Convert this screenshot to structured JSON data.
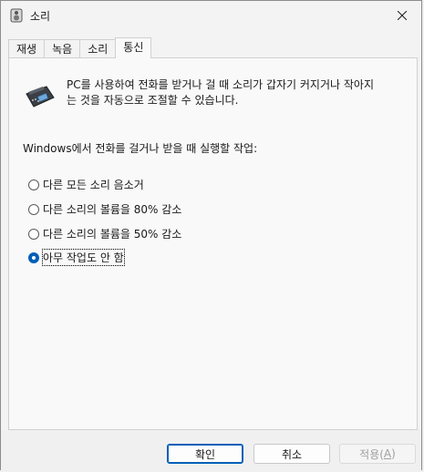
{
  "window": {
    "title": "소리",
    "close_icon": "close-icon"
  },
  "tabs": [
    {
      "label": "재생"
    },
    {
      "label": "녹음"
    },
    {
      "label": "소리"
    },
    {
      "label": "통신"
    }
  ],
  "active_tab": "통신",
  "communications": {
    "description": "PC를 사용하여 전화를 받거나 걸 때 소리가 갑자기 커지거나 작아지는 것을 자동으로 조절할 수 있습니다.",
    "description_line1": "PC를 사용하여 전화를 받거나 걸 때 소리가 갑자기 커지거나 작아지",
    "description_line2": "는 것을 자동으로 조절할 수 있습니다.",
    "question": "Windows에서 전화를 걸거나 받을 때 실행할 작업:",
    "options": [
      {
        "label": "다른 모든 소리 음소거",
        "checked": false
      },
      {
        "label": "다른 소리의 볼륨을 80% 감소",
        "checked": false
      },
      {
        "label": "다른 소리의 볼륨을 50% 감소",
        "checked": false
      },
      {
        "label": "아무 작업도 안 함",
        "checked": true
      }
    ]
  },
  "buttons": {
    "ok": "확인",
    "cancel": "취소",
    "apply_prefix": "적용(",
    "apply_key": "A",
    "apply_suffix": ")"
  },
  "colors": {
    "accent": "#005fb8"
  }
}
